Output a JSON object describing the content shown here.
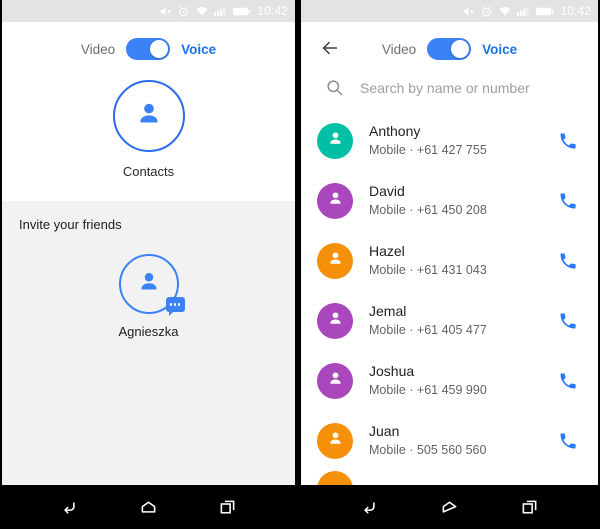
{
  "status_bar": {
    "icons": [
      "mute-icon",
      "alarm-icon",
      "wifi-icon",
      "signal-icon",
      "battery-icon"
    ],
    "time": "10:42"
  },
  "toggle": {
    "left_label": "Video",
    "right_label": "Voice",
    "state": "voice",
    "on_color": "#3b82f6",
    "active_text_color": "#1a73e8",
    "inactive_text_color": "#6b6f73"
  },
  "left_panel": {
    "contacts_card": {
      "icon": "person-icon",
      "label": "Contacts",
      "ring_color": "#2b6ced"
    },
    "invite": {
      "title": "Invite your friends",
      "person": {
        "name": "Agnieszka",
        "icon": "person-icon",
        "badge": "message-bubble-icon"
      }
    }
  },
  "right_panel": {
    "back_icon": "back-arrow-icon",
    "search": {
      "icon": "search-icon",
      "placeholder": "Search by name or number",
      "value": ""
    },
    "contacts": [
      {
        "name": "Anthony",
        "detail": "Mobile · +61 427 755",
        "color": "#00bfa5",
        "call_icon": "phone-icon"
      },
      {
        "name": "David",
        "detail": "Mobile · +61 450 208",
        "color": "#ab47bc",
        "call_icon": "phone-icon"
      },
      {
        "name": "Hazel",
        "detail": "Mobile · +61 431 043",
        "color": "#f79009",
        "call_icon": "phone-icon"
      },
      {
        "name": "Jemal",
        "detail": "Mobile · +61 405 477",
        "color": "#ab47bc",
        "call_icon": "phone-icon"
      },
      {
        "name": "Joshua",
        "detail": "Mobile · +61 459 990",
        "color": "#ab47bc",
        "call_icon": "phone-icon"
      },
      {
        "name": "Juan",
        "detail": "Mobile · 505 560 560",
        "color": "#f79009",
        "call_icon": "phone-icon"
      },
      {
        "name": "",
        "detail": "",
        "color": "#f79009",
        "call_icon": "phone-icon"
      }
    ]
  },
  "nav_bar": {
    "items": [
      {
        "icon": "back-nav-icon"
      },
      {
        "icon": "home-nav-icon"
      },
      {
        "icon": "recents-nav-icon"
      }
    ]
  }
}
